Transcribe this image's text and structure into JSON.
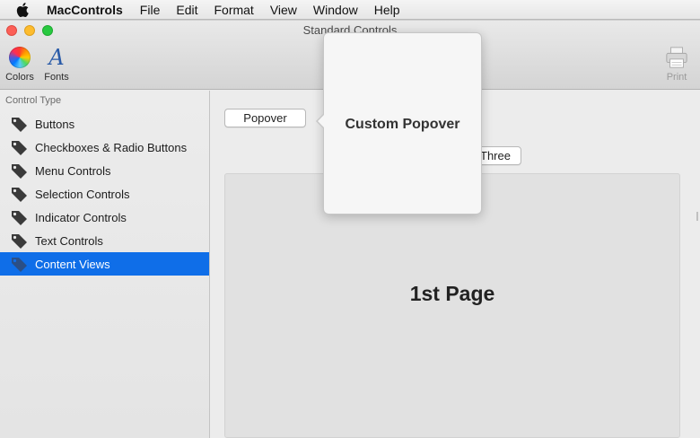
{
  "menubar": {
    "apple_icon": "apple-icon",
    "app_name": "MacControls",
    "items": [
      "File",
      "Edit",
      "Format",
      "View",
      "Window",
      "Help"
    ]
  },
  "window": {
    "title": "Standard Controls"
  },
  "toolbar": {
    "colors_label": "Colors",
    "colors_icon": "color-wheel-icon",
    "fonts_label": "Fonts",
    "fonts_icon": "fonts-icon",
    "fonts_glyph": "A",
    "print_label": "Print",
    "print_icon": "printer-icon",
    "print_enabled": false
  },
  "sidebar": {
    "header": "Control Type",
    "item_icon": "tag-icon",
    "selected_color": "#0f6ee8",
    "items": [
      {
        "label": "Buttons",
        "selected": false
      },
      {
        "label": "Checkboxes & Radio Buttons",
        "selected": false
      },
      {
        "label": "Menu Controls",
        "selected": false
      },
      {
        "label": "Selection Controls",
        "selected": false
      },
      {
        "label": "Indicator Controls",
        "selected": false
      },
      {
        "label": "Text Controls",
        "selected": false
      },
      {
        "label": "Content Views",
        "selected": true
      }
    ]
  },
  "content": {
    "popover_button": "Popover",
    "tab_three": "Three",
    "page_label": "1st Page"
  },
  "popover": {
    "title": "Custom Popover"
  }
}
